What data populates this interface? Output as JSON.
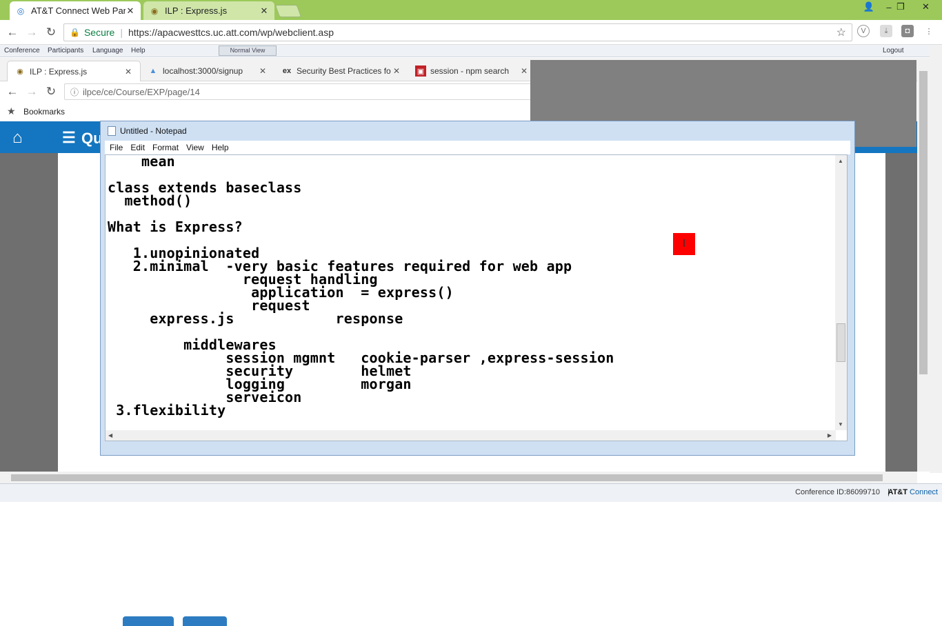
{
  "outer_browser": {
    "tabs": [
      {
        "title": "AT&T Connect Web Partic",
        "close": "✕"
      },
      {
        "title": "ILP : Express.js",
        "close": "✕"
      }
    ],
    "address": {
      "secure_label": "Secure",
      "url": "https://apacwesttcs.uc.att.com/wp/webclient.asp"
    }
  },
  "conference_menu": {
    "items": [
      "Conference",
      "Participants",
      "Language",
      "Help"
    ],
    "normal_view": "Normal View",
    "logout": "Logout"
  },
  "shared_browser": {
    "tabs": [
      {
        "title": "ILP : Express.js",
        "close": "✕"
      },
      {
        "title": "localhost:3000/signup",
        "close": "✕"
      },
      {
        "title": "Security Best Practices fo",
        "close": "✕"
      },
      {
        "title": "session - npm search",
        "close": "✕"
      }
    ],
    "url": "ilpce/ce/Course/EXP/page/14",
    "bookmarks_label": "Bookmarks",
    "header_text": "Qu"
  },
  "notepad": {
    "title": "Untitled - Notepad",
    "menu": [
      "File",
      "Edit",
      "Format",
      "View",
      "Help"
    ],
    "lines": [
      "    mean",
      "",
      "class extends baseclass",
      "  method()",
      "",
      "What is Express?",
      "",
      "   1.unopinionated",
      "   2.minimal  -very basic features required for web app",
      "                request handling",
      "                 application  = express()",
      "                 request",
      "     express.js            response",
      "",
      "         middlewares",
      "              session mgmnt   cookie-parser ,express-session",
      "              security        helmet",
      "              logging         morgan",
      "              serveicon",
      " 3.flexibility"
    ]
  },
  "status_bar": {
    "conference_id": "Conference ID:86099710",
    "separator": "|",
    "brand": "AT&T",
    "brand_suffix": "Connect"
  },
  "colors": {
    "outer_chrome": "#9cc95a",
    "app_header": "#1476c0",
    "cursor_highlight": "#ff0000"
  }
}
